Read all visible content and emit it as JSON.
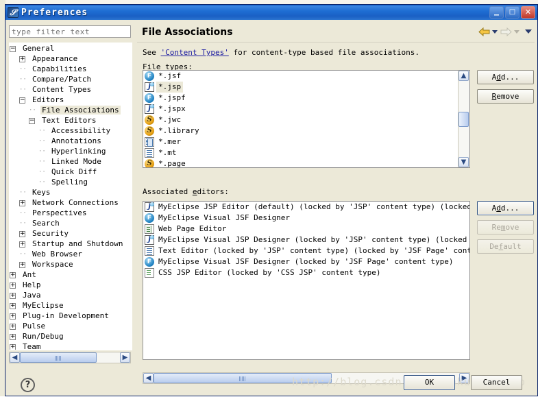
{
  "window": {
    "title": "Preferences",
    "icon": "eclipse-icon",
    "buttons": {
      "minimize": "_",
      "maximize": "□",
      "close": "✕"
    }
  },
  "filter": {
    "placeholder": "type filter text",
    "value": ""
  },
  "tree": [
    {
      "label": "General",
      "depth": 0,
      "expander": "minus",
      "selected": false
    },
    {
      "label": "Appearance",
      "depth": 1,
      "expander": "plus",
      "selected": false
    },
    {
      "label": "Capabilities",
      "depth": 1,
      "expander": "none",
      "selected": false
    },
    {
      "label": "Compare/Patch",
      "depth": 1,
      "expander": "none",
      "selected": false
    },
    {
      "label": "Content Types",
      "depth": 1,
      "expander": "none",
      "selected": false
    },
    {
      "label": "Editors",
      "depth": 1,
      "expander": "minus",
      "selected": false
    },
    {
      "label": "File Associations",
      "depth": 2,
      "expander": "none",
      "selected": true
    },
    {
      "label": "Text Editors",
      "depth": 2,
      "expander": "minus",
      "selected": false
    },
    {
      "label": "Accessibility",
      "depth": 3,
      "expander": "none",
      "selected": false
    },
    {
      "label": "Annotations",
      "depth": 3,
      "expander": "none",
      "selected": false
    },
    {
      "label": "Hyperlinking",
      "depth": 3,
      "expander": "none",
      "selected": false
    },
    {
      "label": "Linked Mode",
      "depth": 3,
      "expander": "none",
      "selected": false
    },
    {
      "label": "Quick Diff",
      "depth": 3,
      "expander": "none",
      "selected": false
    },
    {
      "label": "Spelling",
      "depth": 3,
      "expander": "none",
      "selected": false
    },
    {
      "label": "Keys",
      "depth": 1,
      "expander": "none",
      "selected": false
    },
    {
      "label": "Network Connections",
      "depth": 1,
      "expander": "plus",
      "selected": false
    },
    {
      "label": "Perspectives",
      "depth": 1,
      "expander": "none",
      "selected": false
    },
    {
      "label": "Search",
      "depth": 1,
      "expander": "none",
      "selected": false
    },
    {
      "label": "Security",
      "depth": 1,
      "expander": "plus",
      "selected": false
    },
    {
      "label": "Startup and Shutdown",
      "depth": 1,
      "expander": "plus",
      "selected": false
    },
    {
      "label": "Web Browser",
      "depth": 1,
      "expander": "none",
      "selected": false
    },
    {
      "label": "Workspace",
      "depth": 1,
      "expander": "plus",
      "selected": false
    },
    {
      "label": "Ant",
      "depth": 0,
      "expander": "plus",
      "selected": false
    },
    {
      "label": "Help",
      "depth": 0,
      "expander": "plus",
      "selected": false
    },
    {
      "label": "Java",
      "depth": 0,
      "expander": "plus",
      "selected": false
    },
    {
      "label": "MyEclipse",
      "depth": 0,
      "expander": "plus",
      "selected": false
    },
    {
      "label": "Plug-in Development",
      "depth": 0,
      "expander": "plus",
      "selected": false
    },
    {
      "label": "Pulse",
      "depth": 0,
      "expander": "plus",
      "selected": false
    },
    {
      "label": "Run/Debug",
      "depth": 0,
      "expander": "plus",
      "selected": false
    },
    {
      "label": "Team",
      "depth": 0,
      "expander": "plus",
      "selected": false
    }
  ],
  "page": {
    "title": "File Associations",
    "description_prefix": "See ",
    "description_link": "'Content Types'",
    "description_suffix": " for content-type based file associations.",
    "nav": {
      "back_icon": "back-arrow-icon",
      "forward_icon": "forward-arrow-icon",
      "menu_icon": "chevron-down-icon"
    }
  },
  "file_types": {
    "label_pre": "File ",
    "label_mnemonic": "t",
    "label_post": "ypes:",
    "items": [
      {
        "name": "*.jsf",
        "icon": "jsf-icon",
        "selected": false
      },
      {
        "name": "*.jsp",
        "icon": "jsp-icon",
        "selected": true
      },
      {
        "name": "*.jspf",
        "icon": "jsf-icon",
        "selected": false
      },
      {
        "name": "*.jspx",
        "icon": "jsp-icon",
        "selected": false
      },
      {
        "name": "*.jwc",
        "icon": "library-icon",
        "selected": false
      },
      {
        "name": "*.library",
        "icon": "library-icon",
        "selected": false
      },
      {
        "name": "*.mer",
        "icon": "mer-icon",
        "selected": false
      },
      {
        "name": "*.mt",
        "icon": "doc-icon",
        "selected": false
      },
      {
        "name": "*.page",
        "icon": "library-icon",
        "selected": false
      }
    ],
    "add_label_pre": "A",
    "add_label_mnemonic": "d",
    "add_label_post": "d...",
    "remove_label_mnemonic": "R",
    "remove_label_post": "emove"
  },
  "associated_editors": {
    "label_pre": "Associated ",
    "label_mnemonic": "e",
    "label_post": "ditors:",
    "items": [
      {
        "name": "MyEclipse JSP Editor (default) (locked by 'JSP' content type) (locked by 'JS",
        "icon": "jsp-icon"
      },
      {
        "name": "MyEclipse Visual JSF Designer",
        "icon": "jsf-icon"
      },
      {
        "name": "Web Page Editor",
        "icon": "web-icon"
      },
      {
        "name": "MyEclipse Visual JSP Designer (locked by 'JSP' content type) (locked by 'JSF",
        "icon": "jsp-icon"
      },
      {
        "name": "Text Editor (locked by 'JSP' content type) (locked by 'JSF Page' content typ",
        "icon": "doc-icon"
      },
      {
        "name": "MyEclipse Visual JSF Designer (locked by 'JSF Page' content type)",
        "icon": "jsf-icon"
      },
      {
        "name": "CSS JSP Editor (locked by 'CSS JSP' content type)",
        "icon": "css-icon"
      }
    ],
    "add_label_pre": "A",
    "add_label_mnemonic": "d",
    "add_label_post": "d...",
    "remove_label_pre": "Re",
    "remove_label_mnemonic": "m",
    "remove_label_post": "ove",
    "default_label_pre": "De",
    "default_label_mnemonic": "f",
    "default_label_post": "ault",
    "remove_disabled": true,
    "default_disabled": true
  },
  "footer": {
    "help_icon": "help-question-icon",
    "ok_label": "OK",
    "cancel_label": "Cancel",
    "watermark": "http://blog.csdn.net/lankuezaipiao"
  },
  "colors": {
    "dialog_bg": "#ece9d8",
    "titlebar_blue": "#1f6ed4",
    "selection_bg": "#ece9d8",
    "link": "#1a1aa0",
    "list_bg": "#ffffff"
  }
}
